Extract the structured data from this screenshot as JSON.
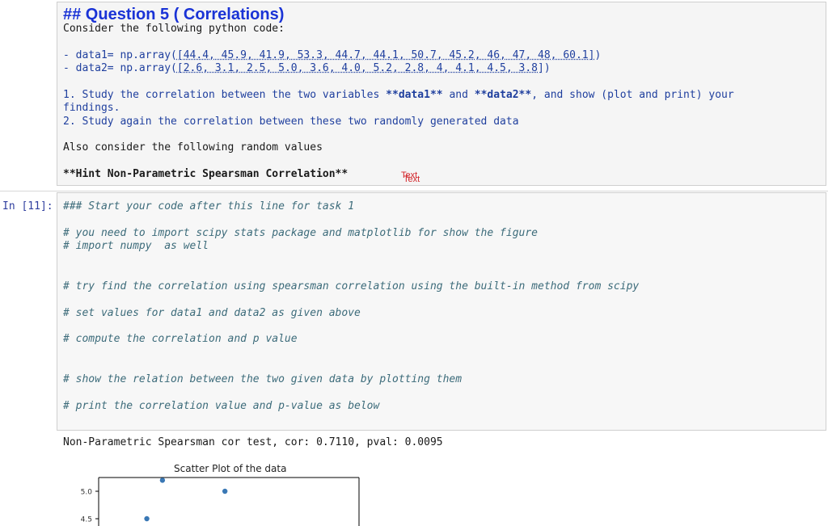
{
  "markdown": {
    "title": "## Question 5 ( Correlations)",
    "intro": "Consider the following python code:",
    "data1_prefix": "- data1= np.array(",
    "data1_values": "[44.4, 45.9, 41.9, 53.3, 44.7, 44.1, 50.7, 45.2, 46, 47, 48, 60.1]",
    "data1_suffix": ")",
    "data2_prefix": "- data2= np.array(",
    "data2_values": "[2.6, 3.1, 2.5, 5.0, 3.6, 4.0, 5.2, 2.8, 4, 4.1, 4.5, 3.8]",
    "data2_suffix": ")",
    "task1_a": "1. Study the correlation between the two variables ",
    "task1_b": "**data1**",
    "task1_c": " and ",
    "task1_d": "**data2**",
    "task1_e": ", and show (plot and print) your",
    "task1_f": "findings.",
    "task2": "2. Study again the correlation between these two randomly generated data",
    "also": "Also consider the following random values",
    "hint": "**Hint Non-Parametric Spearsman Correlation**",
    "badge_a": "Text",
    "badge_b": "Text"
  },
  "code_cell": {
    "prompt": "In [11]:",
    "lines": [
      "### Start your code after this line for task 1",
      "# you need to import scipy stats package and matplotlib for show the figure",
      "# import numpy  as well",
      "# try find the correlation using spearsman correlation using the built-in method from scipy",
      "# set values for data1 and data2 as given above",
      "# compute the correlation and p value",
      "# show the relation between the two given data by plotting them",
      "# print the correlation value and p-value as below"
    ]
  },
  "output": {
    "text": "Non-Parametric Spearsman cor test, cor: 0.7110, pval: 0.0095"
  },
  "chart_data": {
    "type": "scatter",
    "title": "Scatter Plot of the data",
    "yticks": [
      "5.0",
      "4.5"
    ],
    "points": [
      {
        "x": 45.9,
        "y": 5.2
      },
      {
        "x": 50.7,
        "y": 5.0
      },
      {
        "x": 44.7,
        "y": 4.5
      }
    ],
    "color": "#3a78b5"
  }
}
